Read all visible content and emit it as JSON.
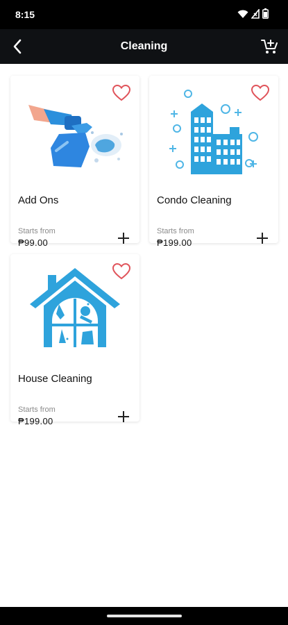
{
  "status": {
    "time": "8:15"
  },
  "appbar": {
    "title": "Cleaning",
    "back_icon": "chevron-left-icon",
    "cart_icon": "cart-add-icon"
  },
  "colors": {
    "accent_blue": "#2ea3dc",
    "heart": "#e0535a",
    "bar": "#0f1114"
  },
  "items": [
    {
      "name": "Add Ons",
      "starts_label": "Starts from",
      "price": "₱99.00",
      "image": "spray-bottle-cleaning"
    },
    {
      "name": "Condo Cleaning",
      "starts_label": "Starts from",
      "price": "₱199.00",
      "image": "condo-building"
    },
    {
      "name": "House Cleaning",
      "starts_label": "Starts from",
      "price": "₱199.00",
      "image": "house-window-cleaning"
    }
  ]
}
